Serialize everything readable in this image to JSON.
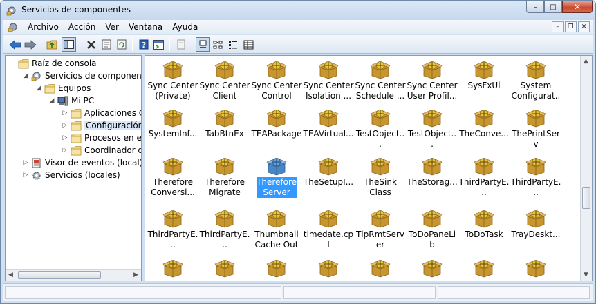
{
  "window": {
    "title": "Servicios de componentes",
    "controls": {
      "minimize": "–",
      "maximize": "□",
      "close": "✕"
    }
  },
  "menu": {
    "items": [
      "Archivo",
      "Acción",
      "Ver",
      "Ventana",
      "Ayuda"
    ],
    "mdi": {
      "minimize": "–",
      "restore": "❐",
      "close": "✕"
    }
  },
  "toolbar": {
    "buttons": [
      "back-icon",
      "forward-icon",
      "up-folder-icon",
      "show-tree-icon",
      "delete-icon",
      "properties-icon",
      "refresh-icon",
      "help-icon",
      "console-icon",
      "new-window-icon",
      "large-icons-view-icon",
      "small-icons-view-icon",
      "list-view-icon",
      "details-view-icon"
    ]
  },
  "tree": [
    {
      "label": "Raíz de consola",
      "level": 0,
      "twisty": "",
      "icon": "folder-open-icon"
    },
    {
      "label": "Servicios de componentes",
      "level": 1,
      "twisty": "◢",
      "icon": "component-services-icon"
    },
    {
      "label": "Equipos",
      "level": 2,
      "twisty": "◢",
      "icon": "folder-icon"
    },
    {
      "label": "Mi PC",
      "level": 3,
      "twisty": "◢",
      "icon": "computer-icon"
    },
    {
      "label": "Aplicaciones COM+",
      "level": 4,
      "twisty": "▷",
      "icon": "folder-icon"
    },
    {
      "label": "Configuración DCOM",
      "level": 4,
      "twisty": "▷",
      "icon": "folder-icon",
      "selected": true
    },
    {
      "label": "Procesos en ejecución",
      "level": 4,
      "twisty": "▷",
      "icon": "folder-icon"
    },
    {
      "label": "Coordinador de transacciones distribuidas",
      "level": 4,
      "twisty": "▷",
      "icon": "folder-icon"
    },
    {
      "label": "Visor de eventos (local)",
      "level": 1,
      "twisty": "▷",
      "icon": "event-viewer-icon"
    },
    {
      "label": "Servicios (locales)",
      "level": 1,
      "twisty": "▷",
      "icon": "services-gear-icon"
    }
  ],
  "items": [
    [
      "Sync Center (Private)",
      "Sync Center Client",
      "Sync Center Control",
      "Sync Center Isolation ...",
      "Sync Center Schedule ...",
      "Sync Center User Profil...",
      "SysFxUi",
      "System Configurat..."
    ],
    [
      "SystemInf...",
      "TabBtnEx",
      "TEAPackage",
      "TEAVirtual...",
      "TestObject...",
      "TestObject...",
      "TheConve...",
      "ThePrintServ"
    ],
    [
      "Therefore Conversi...",
      "Therefore Migrate",
      "Therefore Server",
      "TheSetupI...",
      "TheSink Class",
      "TheStorag...",
      "ThirdPartyE...",
      "ThirdPartyE..."
    ],
    [
      "ThirdPartyE...",
      "ThirdPartyE...",
      "Thumbnail Cache Out ...",
      "timedate.cpl",
      "TlpRmtServer",
      "ToDoPaneLib",
      "ToDoTask",
      "TrayDeskt..."
    ],
    [
      "",
      "",
      "",
      "",
      "",
      "",
      "",
      ""
    ]
  ],
  "selected_item": "Therefore Server",
  "colors": {
    "selection": "#3399ff",
    "package": "#c8962e",
    "package_selected": "#4a86c5"
  }
}
